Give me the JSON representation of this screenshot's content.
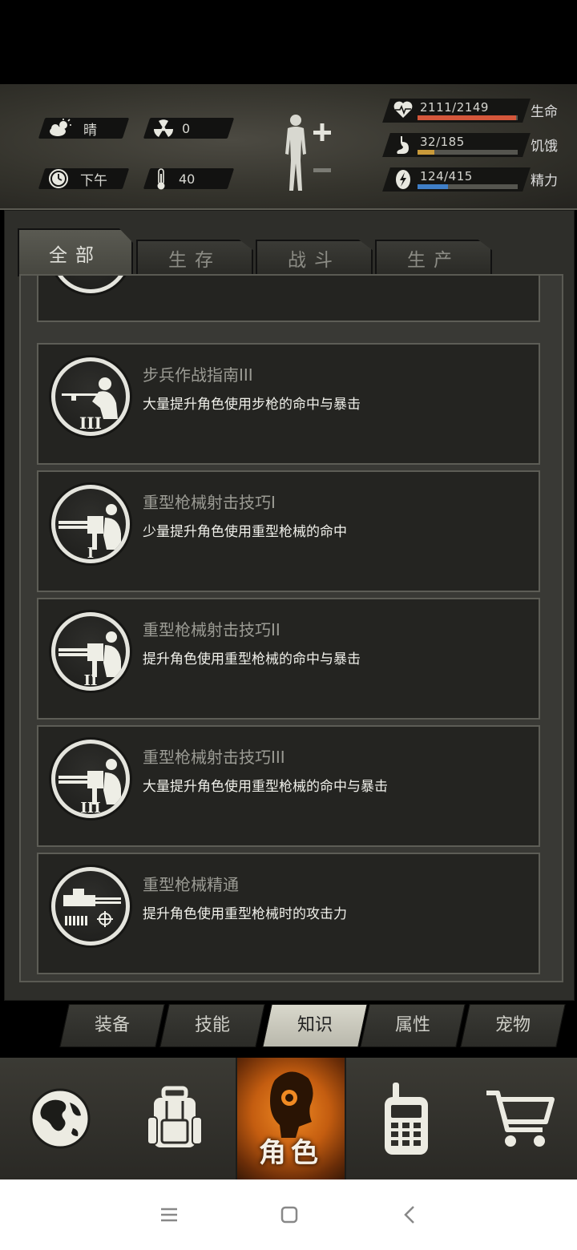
{
  "hud": {
    "weather": {
      "icon": "cloud-sun-icon",
      "label": "晴"
    },
    "radiation": {
      "icon": "radiation-icon",
      "value": "0"
    },
    "time": {
      "icon": "clock-icon",
      "label": "下午"
    },
    "temperature": {
      "icon": "thermometer-icon",
      "value": "40"
    },
    "stats": [
      {
        "icon": "heart-icon",
        "value": "2111/2149",
        "label": "生命",
        "fill": 0.98,
        "color": "#d4573b"
      },
      {
        "icon": "stomach-icon",
        "value": "32/185",
        "label": "饥饿",
        "fill": 0.17,
        "color": "#c99a3a"
      },
      {
        "icon": "energy-icon",
        "value": "124/415",
        "label": "精力",
        "fill": 0.3,
        "color": "#3f7fc8"
      }
    ]
  },
  "tabs": [
    {
      "label": "全部",
      "active": true
    },
    {
      "label": "生存",
      "active": false
    },
    {
      "label": "战斗",
      "active": false
    },
    {
      "label": "生产",
      "active": false
    }
  ],
  "skills": [
    {
      "title": "步兵作战指南III",
      "desc": "大量提升角色使用步枪的命中与暴击",
      "icon": "rifleman-icon",
      "rank": "III"
    },
    {
      "title": "重型枪械射击技巧I",
      "desc": "少量提升角色使用重型枪械的命中",
      "icon": "minigun-icon",
      "rank": "I"
    },
    {
      "title": "重型枪械射击技巧II",
      "desc": "提升角色使用重型枪械的命中与暴击",
      "icon": "minigun-icon",
      "rank": "II"
    },
    {
      "title": "重型枪械射击技巧III",
      "desc": "大量提升角色使用重型枪械的命中与暴击",
      "icon": "minigun-icon",
      "rank": "III"
    },
    {
      "title": "重型枪械精通",
      "desc": "提升角色使用重型枪械时的攻击力",
      "icon": "heavy-gun-icon",
      "rank": ""
    }
  ],
  "subtabs": [
    {
      "label": "装备",
      "active": false
    },
    {
      "label": "技能",
      "active": false
    },
    {
      "label": "知识",
      "active": true
    },
    {
      "label": "属性",
      "active": false
    },
    {
      "label": "宠物",
      "active": false
    }
  ],
  "bottom_nav": [
    {
      "icon": "globe-icon",
      "label": ""
    },
    {
      "icon": "backpack-icon",
      "label": ""
    },
    {
      "icon": "character-head-icon",
      "label": "角色",
      "active": true
    },
    {
      "icon": "walkie-talkie-icon",
      "label": ""
    },
    {
      "icon": "shopping-cart-icon",
      "label": ""
    }
  ],
  "system_nav": [
    {
      "icon": "menu-icon"
    },
    {
      "icon": "home-square-icon"
    },
    {
      "icon": "back-chevron-icon"
    }
  ]
}
